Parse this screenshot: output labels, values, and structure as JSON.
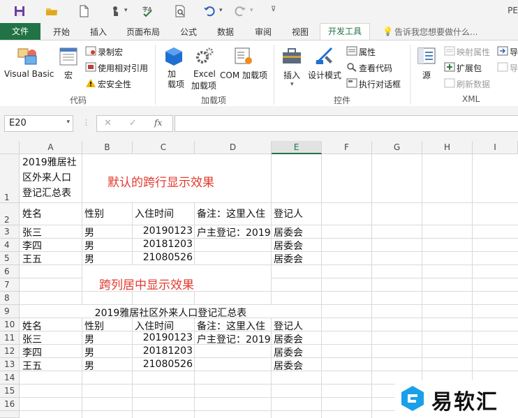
{
  "window": {
    "title": "PE"
  },
  "qat": {
    "icons": [
      "save-icon",
      "open-icon",
      "new-icon",
      "touch-icon",
      "spell-icon",
      "preview-icon",
      "undo-icon",
      "redo-icon",
      "customize-icon"
    ]
  },
  "tabs": {
    "file": "文件",
    "items": [
      "开始",
      "插入",
      "页面布局",
      "公式",
      "数据",
      "审阅",
      "视图"
    ],
    "active": "开发工具",
    "tellme": "告诉我您想要做什么..."
  },
  "ribbon": {
    "code": {
      "visual_basic": "Visual Basic",
      "macro": "宏",
      "record_macro": "录制宏",
      "relative_ref": "使用相对引用",
      "macro_security": "宏安全性",
      "group": "代码"
    },
    "addins": {
      "addins": "加\n载项",
      "excel_addins_1": "Excel",
      "excel_addins_2": "加载项",
      "com_addins": "COM 加载项",
      "group": "加载项"
    },
    "controls": {
      "insert": "插入",
      "design_mode": "设计模式",
      "properties": "属性",
      "view_code": "查看代码",
      "run_dialog": "执行对话框",
      "group": "控件"
    },
    "xml": {
      "source": "源",
      "map_props": "映射属性",
      "expansion": "扩展包",
      "refresh": "刷新数据",
      "import": "导",
      "export": "导",
      "group": "XML"
    }
  },
  "formula_bar": {
    "name_box": "E20",
    "cancel": "✕",
    "enter": "✓",
    "fx": "fx",
    "formula": ""
  },
  "sheet": {
    "columns": [
      "A",
      "B",
      "C",
      "D",
      "E",
      "F",
      "G",
      "H",
      "I"
    ],
    "rows": [
      "1",
      "2",
      "3",
      "4",
      "5",
      "6",
      "7",
      "8",
      "9",
      "10",
      "11",
      "12",
      "13",
      "14",
      "15",
      "16"
    ],
    "a1_lines": [
      "2019雅居社",
      "区外来人口",
      "登记汇总表"
    ],
    "note1": "默认的跨行显示效果",
    "note2": "跨列居中显示效果",
    "title9": "2019雅居社区外来人口登记汇总表",
    "headers": [
      "姓名",
      "性别",
      "入住时间",
      "备注：这里入住",
      "登记人"
    ],
    "records": [
      [
        "张三",
        "男",
        "20190123",
        "户主登记：2019",
        "居委会"
      ],
      [
        "李四",
        "男",
        "20181203",
        "",
        "居委会"
      ],
      [
        "王五",
        "男",
        "21080526",
        "",
        "居委会"
      ]
    ]
  },
  "watermark": {
    "text": "易软汇"
  },
  "colors": {
    "excel_green": "#217346",
    "red_note": "#e23a2e",
    "logo_blue": "#1aa0e8"
  }
}
